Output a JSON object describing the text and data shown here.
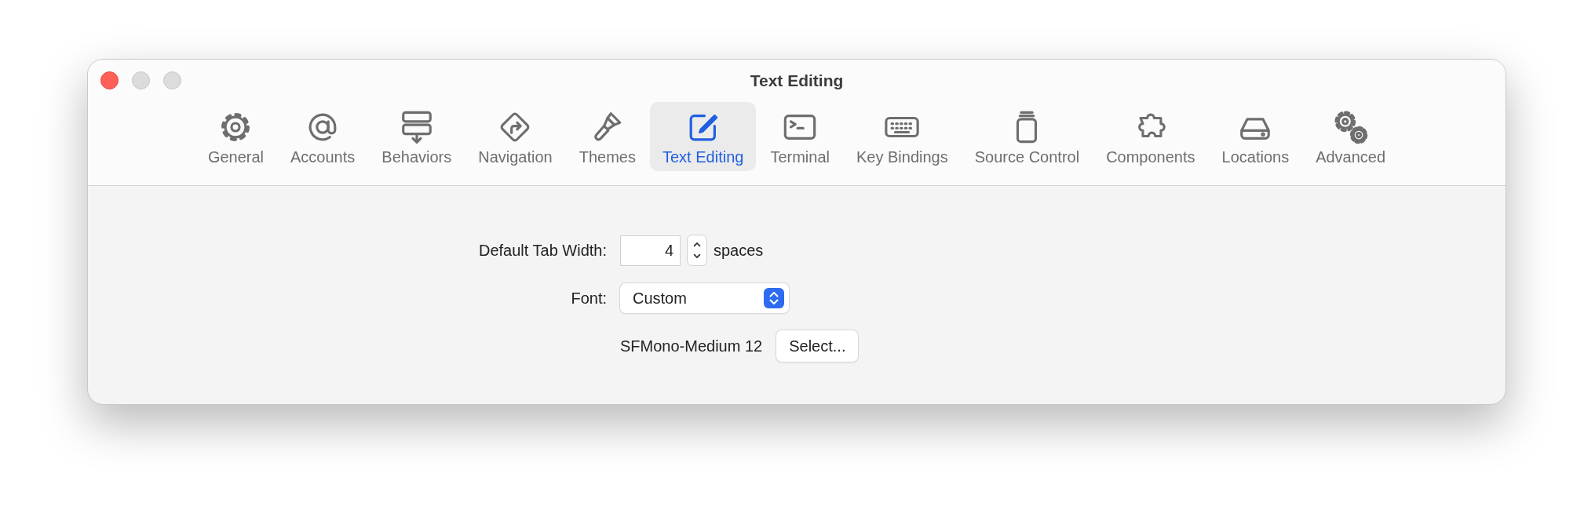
{
  "window": {
    "title": "Text Editing"
  },
  "tabs": [
    {
      "label": "General",
      "kind": "gear",
      "selected": false
    },
    {
      "label": "Accounts",
      "kind": "at",
      "selected": false
    },
    {
      "label": "Behaviors",
      "kind": "behaviors",
      "selected": false
    },
    {
      "label": "Navigation",
      "kind": "navigation",
      "selected": false
    },
    {
      "label": "Themes",
      "kind": "brush",
      "selected": false
    },
    {
      "label": "Text Editing",
      "kind": "edit",
      "selected": true
    },
    {
      "label": "Terminal",
      "kind": "terminal",
      "selected": false
    },
    {
      "label": "Key Bindings",
      "kind": "keyboard",
      "selected": false
    },
    {
      "label": "Source Control",
      "kind": "source",
      "selected": false
    },
    {
      "label": "Components",
      "kind": "puzzle",
      "selected": false
    },
    {
      "label": "Locations",
      "kind": "drive",
      "selected": false
    },
    {
      "label": "Advanced",
      "kind": "gears",
      "selected": false
    }
  ],
  "settings": {
    "tab_width": {
      "label": "Default Tab Width:",
      "value": "4",
      "unit": "spaces"
    },
    "font": {
      "label": "Font:",
      "value": "Custom"
    },
    "font_name": "SFMono-Medium 12",
    "select_button": "Select..."
  }
}
